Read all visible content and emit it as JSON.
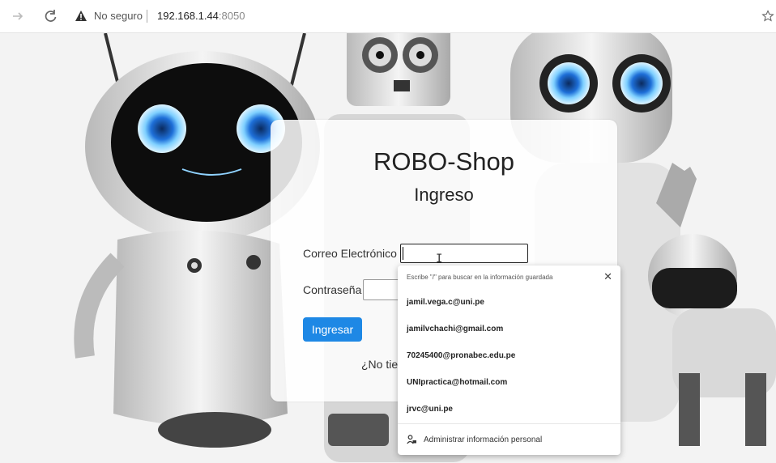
{
  "browser": {
    "security_label": "No seguro",
    "url_host": "192.168.1.44",
    "url_port": ":8050"
  },
  "card": {
    "title": "ROBO-Shop",
    "subtitle": "Ingreso",
    "email_label": "Correo Electrónico",
    "password_label": "Contraseña",
    "submit_label": "Ingresar",
    "register_text": "¿No tie"
  },
  "autofill": {
    "hint": "Escribe \"/\" para buscar en la información guardada",
    "items": [
      "jamil.vega.c@uni.pe",
      "jamilvchachi@gmail.com",
      "70245400@pronabec.edu.pe",
      "UNIpractica@hotmail.com",
      "jrvc@uni.pe"
    ],
    "manage_label": "Administrar información personal"
  },
  "colors": {
    "primary_button": "#1e88e5",
    "warning": "#333333"
  }
}
